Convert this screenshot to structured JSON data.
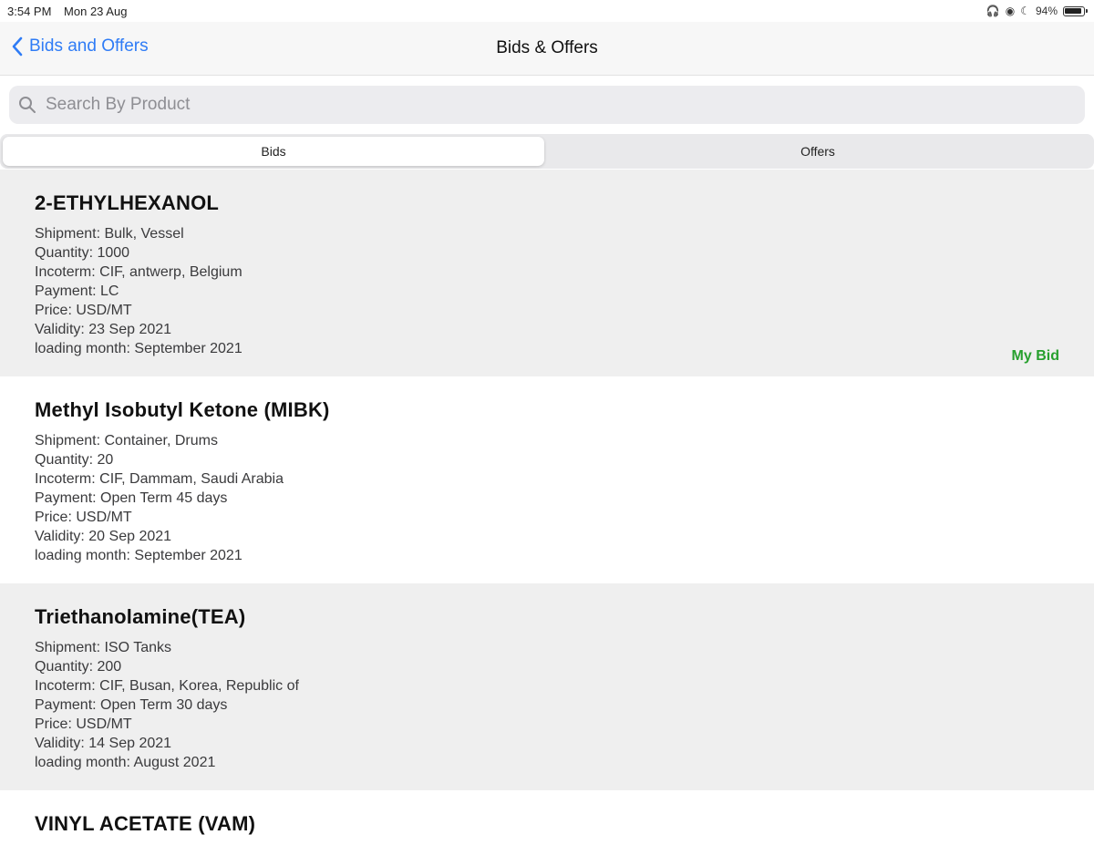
{
  "status_bar": {
    "time": "3:54 PM",
    "date": "Mon 23 Aug",
    "battery": "94%",
    "battery_level": 0.94
  },
  "nav": {
    "back_label": "Bids and Offers",
    "title": "Bids & Offers"
  },
  "search": {
    "placeholder": "Search By Product",
    "value": ""
  },
  "segments": {
    "bids": "Bids",
    "offers": "Offers",
    "selected": "Bids"
  },
  "items": [
    {
      "title": "2-ETHYLHEXANOL",
      "lines": [
        "Shipment: Bulk, Vessel",
        "Quantity: 1000",
        "Incoterm: CIF, antwerp, Belgium",
        "Payment: LC",
        "Price:  USD/MT",
        "Validity: 23 Sep 2021",
        "loading month: September 2021"
      ],
      "badge": "My Bid"
    },
    {
      "title": "Methyl Isobutyl Ketone (MIBK)",
      "lines": [
        "Shipment: Container, Drums",
        "Quantity: 20",
        "Incoterm: CIF, Dammam, Saudi Arabia",
        "Payment: Open Term 45 days",
        "Price:  USD/MT",
        "Validity: 20 Sep 2021",
        "loading month: September 2021"
      ]
    },
    {
      "title": "Triethanolamine(TEA)",
      "lines": [
        "Shipment: ISO Tanks",
        "Quantity: 200",
        "Incoterm: CIF, Busan, Korea, Republic of",
        "Payment: Open Term 30 days",
        "Price:  USD/MT",
        "Validity: 14 Sep 2021",
        "loading month: August 2021"
      ]
    },
    {
      "title": "VINYL ACETATE (VAM)"
    }
  ],
  "colors": {
    "accent": "#2f7cf6",
    "badge": "#27a02e"
  }
}
